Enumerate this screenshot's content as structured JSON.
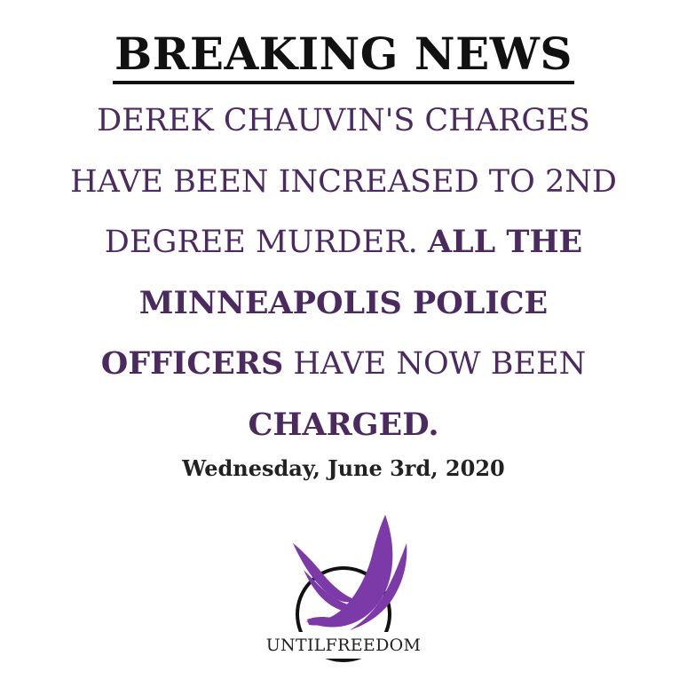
{
  "headline": "BREAKING NEWS",
  "body_lines": [
    [
      {
        "text": "DEREK CHAUVIN'S CHARGES",
        "bold": false
      }
    ],
    [
      {
        "text": "HAVE BEEN INCREASED TO 2ND",
        "bold": false
      }
    ],
    [
      {
        "text": "DEGREE MURDER. ",
        "bold": false
      },
      {
        "text": "ALL THE",
        "bold": true
      }
    ],
    [
      {
        "text": "MINNEAPOLIS POLICE",
        "bold": true
      }
    ],
    [
      {
        "text": "OFFICERS",
        "bold": true
      },
      {
        "text": " HAVE NOW BEEN",
        "bold": false
      }
    ],
    [
      {
        "text": "CHARGED.",
        "bold": true
      }
    ]
  ],
  "date": "Wednesday, June 3rd, 2020",
  "logo": {
    "text": "UNTILFREEDOM",
    "icon": "purple-wings-logo-icon",
    "accent_color": "#7b3aa8"
  },
  "colors": {
    "headline": "#111111",
    "body_text": "#4a2a5f",
    "date": "#222222",
    "background": "#ffffff"
  }
}
